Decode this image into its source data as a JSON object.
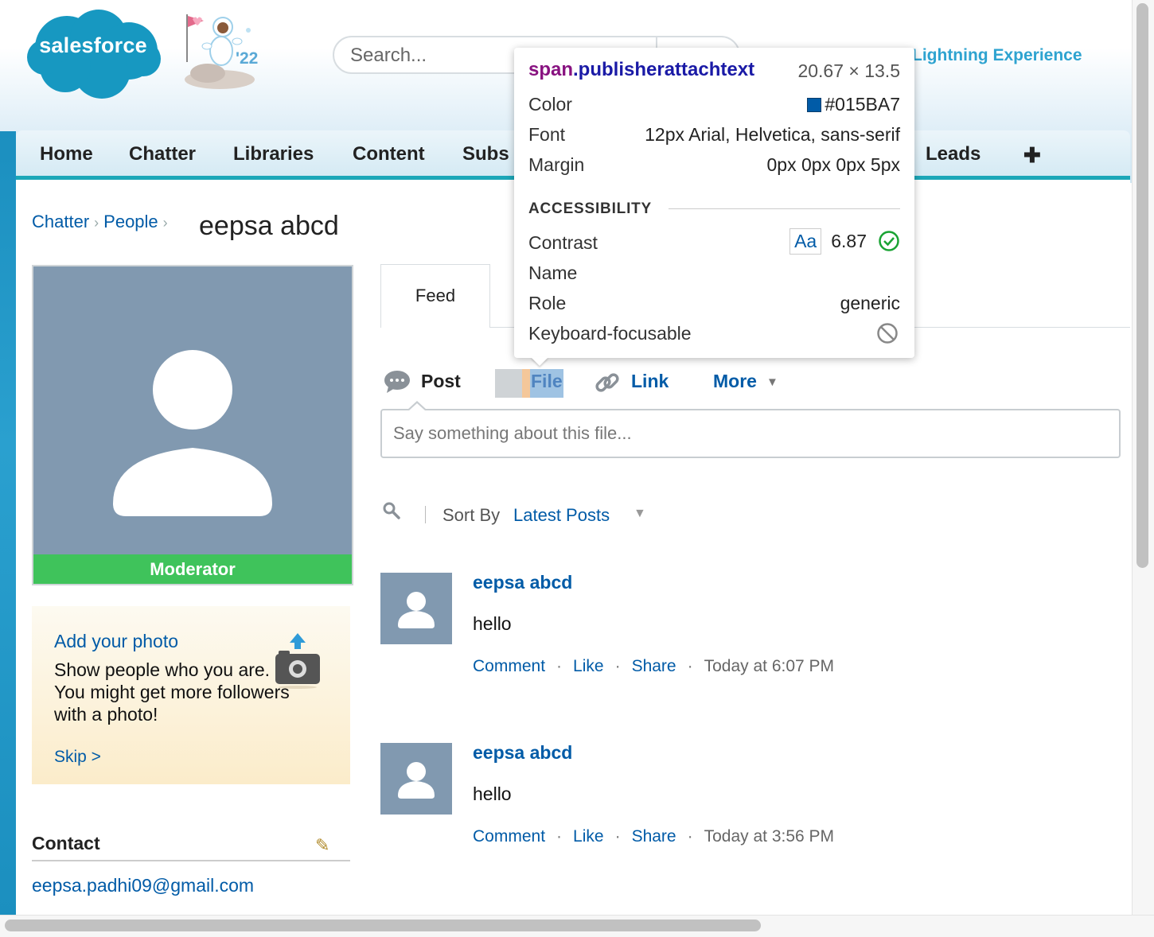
{
  "header": {
    "logo_text": "salesforce",
    "mascot_year": "'22",
    "search_placeholder": "Search...",
    "lightning_link": "Lightning Experience"
  },
  "nav": {
    "items": [
      "Home",
      "Chatter",
      "Libraries",
      "Content",
      "Subs",
      "Leads"
    ],
    "add_icon": "plus-icon"
  },
  "breadcrumb": {
    "items": [
      "Chatter",
      "People"
    ],
    "separator": "›",
    "current": "eepsa abcd"
  },
  "profile": {
    "badge": "Moderator",
    "photo_color": "#8199b0",
    "badge_color": "#3fc35b"
  },
  "add_photo": {
    "title": "Add your photo",
    "text": "Show people who you are. You might get more followers with a photo!",
    "skip": "Skip >"
  },
  "contact": {
    "heading": "Contact",
    "email": "eepsa.padhi09@gmail.com"
  },
  "feed": {
    "tab_label": "Feed",
    "publisher": {
      "post": "Post",
      "file": "File",
      "link": "Link",
      "more": "More",
      "placeholder": "Say something about this file..."
    },
    "sort": {
      "label": "Sort By",
      "value": "Latest Posts"
    },
    "posts": [
      {
        "author": "eepsa abcd",
        "body": "hello",
        "comment": "Comment",
        "like": "Like",
        "share": "Share",
        "time": "Today at 6:07 PM"
      },
      {
        "author": "eepsa abcd",
        "body": "hello",
        "comment": "Comment",
        "like": "Like",
        "share": "Share",
        "time": "Today at 3:56 PM"
      }
    ]
  },
  "inspector": {
    "tag": "span",
    "class": ".publisherattachtext",
    "size": "20.67 × 13.5",
    "rows": {
      "color_label": "Color",
      "color_value": "#015BA7",
      "font_label": "Font",
      "font_value": "12px Arial, Helvetica, sans-serif",
      "margin_label": "Margin",
      "margin_value": "0px 0px 0px 5px"
    },
    "accessibility": {
      "heading": "ACCESSIBILITY",
      "contrast_label": "Contrast",
      "contrast_sample": "Aa",
      "contrast_value": "6.87",
      "name_label": "Name",
      "role_label": "Role",
      "role_value": "generic",
      "focus_label": "Keyboard-focusable"
    }
  },
  "colors": {
    "link": "#015ba7",
    "nav_accent": "#1ca7b8",
    "lightning": "#2ea3d0"
  }
}
